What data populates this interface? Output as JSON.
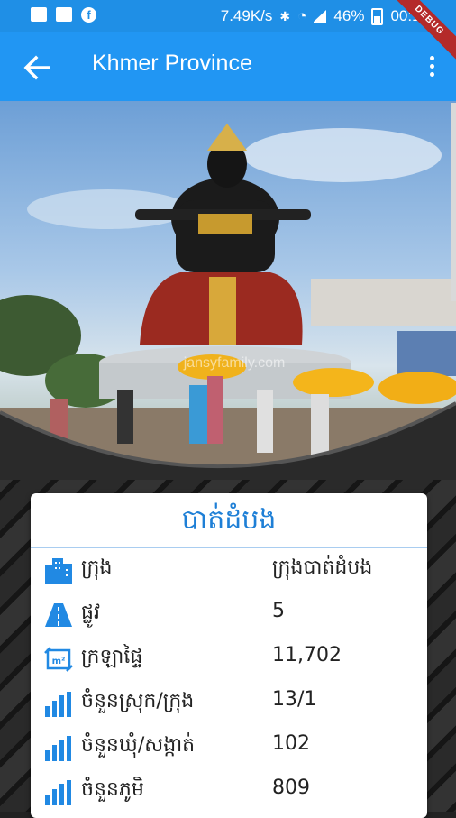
{
  "status_bar": {
    "speed": "7.49K/s",
    "battery": "46%",
    "time": "00:10",
    "icons": [
      "image-icon",
      "android-icon",
      "facebook-icon",
      "bluetooth-icon",
      "wifi-icon",
      "signal-icon",
      "battery-icon"
    ]
  },
  "debug_banner": "DEBUG",
  "app_bar": {
    "title": "Khmer Province",
    "back_icon": "arrow-back-icon",
    "menu_icon": "more-vert-icon"
  },
  "hero": {
    "watermark": "jansyfamily.com"
  },
  "card": {
    "title": "បាត់ដំបង",
    "rows": [
      {
        "icon": "city-icon",
        "label": "ក្រុង",
        "value": "ក្រុងបាត់ដំបង"
      },
      {
        "icon": "road-icon",
        "label": "ផ្លូវ",
        "value": "5"
      },
      {
        "icon": "area-icon",
        "label": "ក្រឡាផ្ទៃ",
        "value": "11,702"
      },
      {
        "icon": "bar-chart-icon",
        "label": "ចំនួនស្រុក/ក្រុង",
        "value": "13/1"
      },
      {
        "icon": "bar-chart-icon",
        "label": "ចំនួនឃុំ/សង្កាត់",
        "value": "102"
      },
      {
        "icon": "bar-chart-icon",
        "label": "ចំនួនភូមិ",
        "value": "809"
      }
    ]
  },
  "colors": {
    "accent": "#2196f3",
    "status_bar": "#1f8fe6",
    "icon_blue": "#2189e3",
    "title_blue": "#1e7fd6"
  }
}
